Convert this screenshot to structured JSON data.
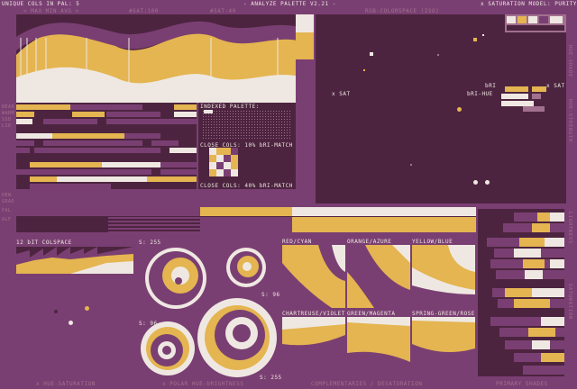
{
  "header": {
    "unique_cols": "UNIQUE COLS IN PAL: 5",
    "sub_left": "< MAX  MIN  AVG  >",
    "sat_info": "#SAT:100",
    "val_info": "#SAT:40",
    "title": "- ANALYZE PALETTE V2.21 -",
    "colorspace": "RGB-COLORSPACE (ISO)",
    "saturation_model": "x SATURATION MODEL: PURITY"
  },
  "labels": {
    "indexed_palette": "INDEXED PALETTE:",
    "close_cols_1": "CLOSE COLS: 10% bRI-MATCH",
    "close_cols_2": "CLOSE COLS: 40% bRI-MATCH",
    "x_sat": "x SAT",
    "bri_label": "bRI",
    "bri_hue": "bRI-HUE",
    "x_sat_right": "x SAT",
    "bit12": "12 bIT COLSPACE",
    "s255_a": "S: 255",
    "s96_a": "S: 96",
    "s96_b": "S: 96",
    "s255_b": "S: 255",
    "red_cyan": "RED/CYAN",
    "orange_azure": "ORANGE/AZURE",
    "yellow_blue": "YELLOW/BLUE",
    "chartreuse_violet": "CHARTREUSE/VIOLET",
    "green_magenta": "GREEN/MAGENTA",
    "spring_rose": "SPRING-GREEN/ROSE"
  },
  "footer": {
    "hue_saturation": "x HUE-SATURATION",
    "polar": "x POLAR HUE-bRIGHTNESS",
    "complementaries": "COMPLEMENTARIES / DESATURATION",
    "primary": "PRIMARY SHADES"
  },
  "side_labels": {
    "left": [
      "NEAR",
      "WARM",
      "SSD",
      "LSD"
    ],
    "left2": [
      "HEW",
      "GRAD",
      "PAL",
      "ALF"
    ],
    "right": [
      "HUE-SHADE",
      "HUE-STRENGTH",
      "LIGHTNESS",
      "SATURATION"
    ]
  },
  "colors": {
    "bg": "#7a3f72",
    "panel": "#4d2440",
    "cream": "#efe8e2",
    "gold": "#e4b550",
    "purple": "#7a3f72",
    "mauve": "#a2708f"
  },
  "palette": [
    "#4d2440",
    "#7a3f72",
    "#a2708f",
    "#e4b550",
    "#efe8e2"
  ]
}
